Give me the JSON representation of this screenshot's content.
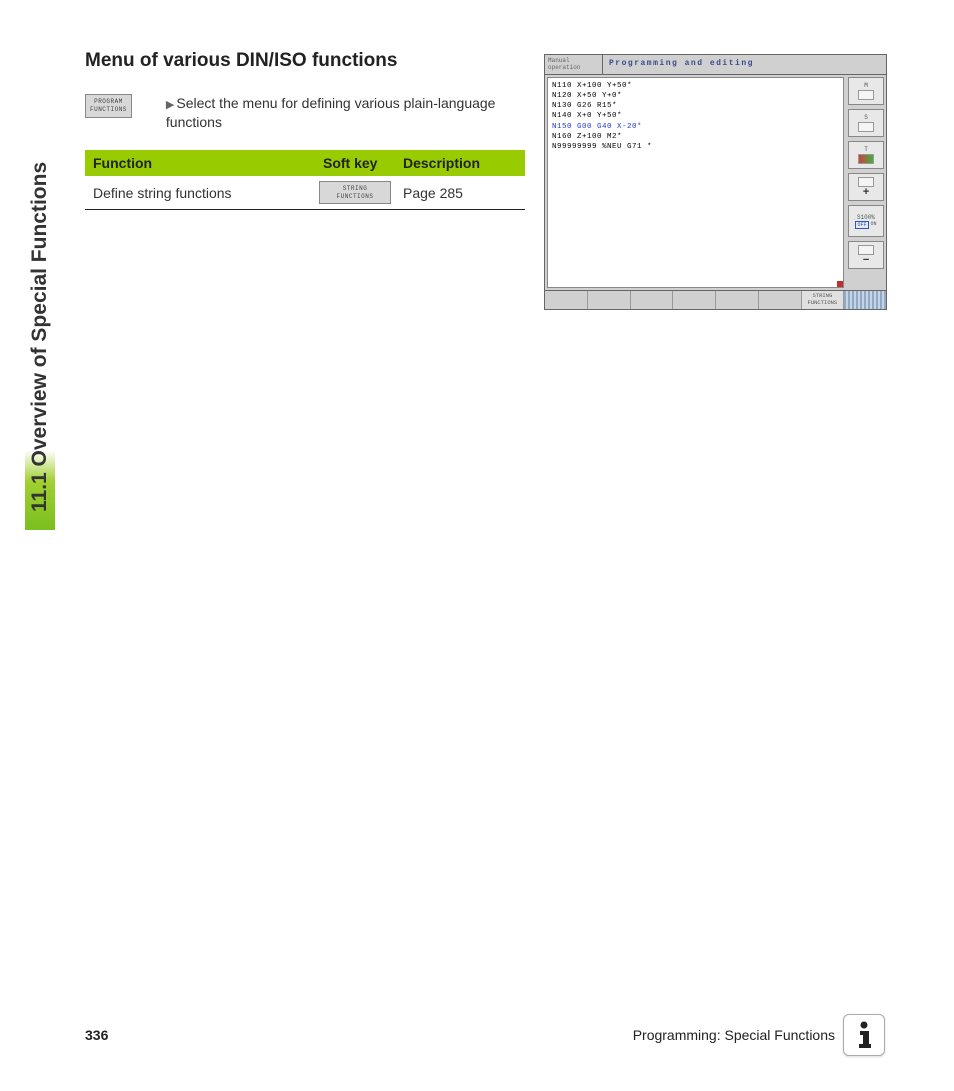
{
  "sidebar": {
    "title": "11.1 Overview of Special Functions"
  },
  "content": {
    "heading": "Menu of various DIN/ISO functions",
    "softkey_program_functions_line1": "PROGRAM",
    "softkey_program_functions_line2": "FUNCTIONS",
    "instruction": "Select the menu for defining various plain-language functions"
  },
  "table": {
    "headers": {
      "function": "Function",
      "softkey": "Soft key",
      "description": "Description"
    },
    "rows": [
      {
        "function": "Define string functions",
        "softkey_line1": "STRING",
        "softkey_line2": "FUNCTIONS",
        "description": "Page 285"
      }
    ]
  },
  "screenshot": {
    "mode_line1": "Manual",
    "mode_line2": "operation",
    "title": "Programming and editing",
    "code": {
      "l1": "N110 X+100 Y+50*",
      "l2": "N120 X+50 Y+0*",
      "l3": "N130 G26 R15*",
      "l4": "N140 X+0 Y+50*",
      "l5": "N150 G00 G40 X-20*",
      "l6": "N160 Z+100 M2*",
      "l7": "N99999999 %NEU G71 *"
    },
    "right_buttons": {
      "b1": "M",
      "b2": "S",
      "b3": "T",
      "b4_plus": "+",
      "b5_line1": "S100%",
      "b5_off": "OFF",
      "b5_on": "ON",
      "b6_minus": "−"
    },
    "footer_softkey_line1": "STRING",
    "footer_softkey_line2": "FUNCTIONS"
  },
  "footer": {
    "page_number": "336",
    "chapter": "Programming: Special Functions"
  }
}
